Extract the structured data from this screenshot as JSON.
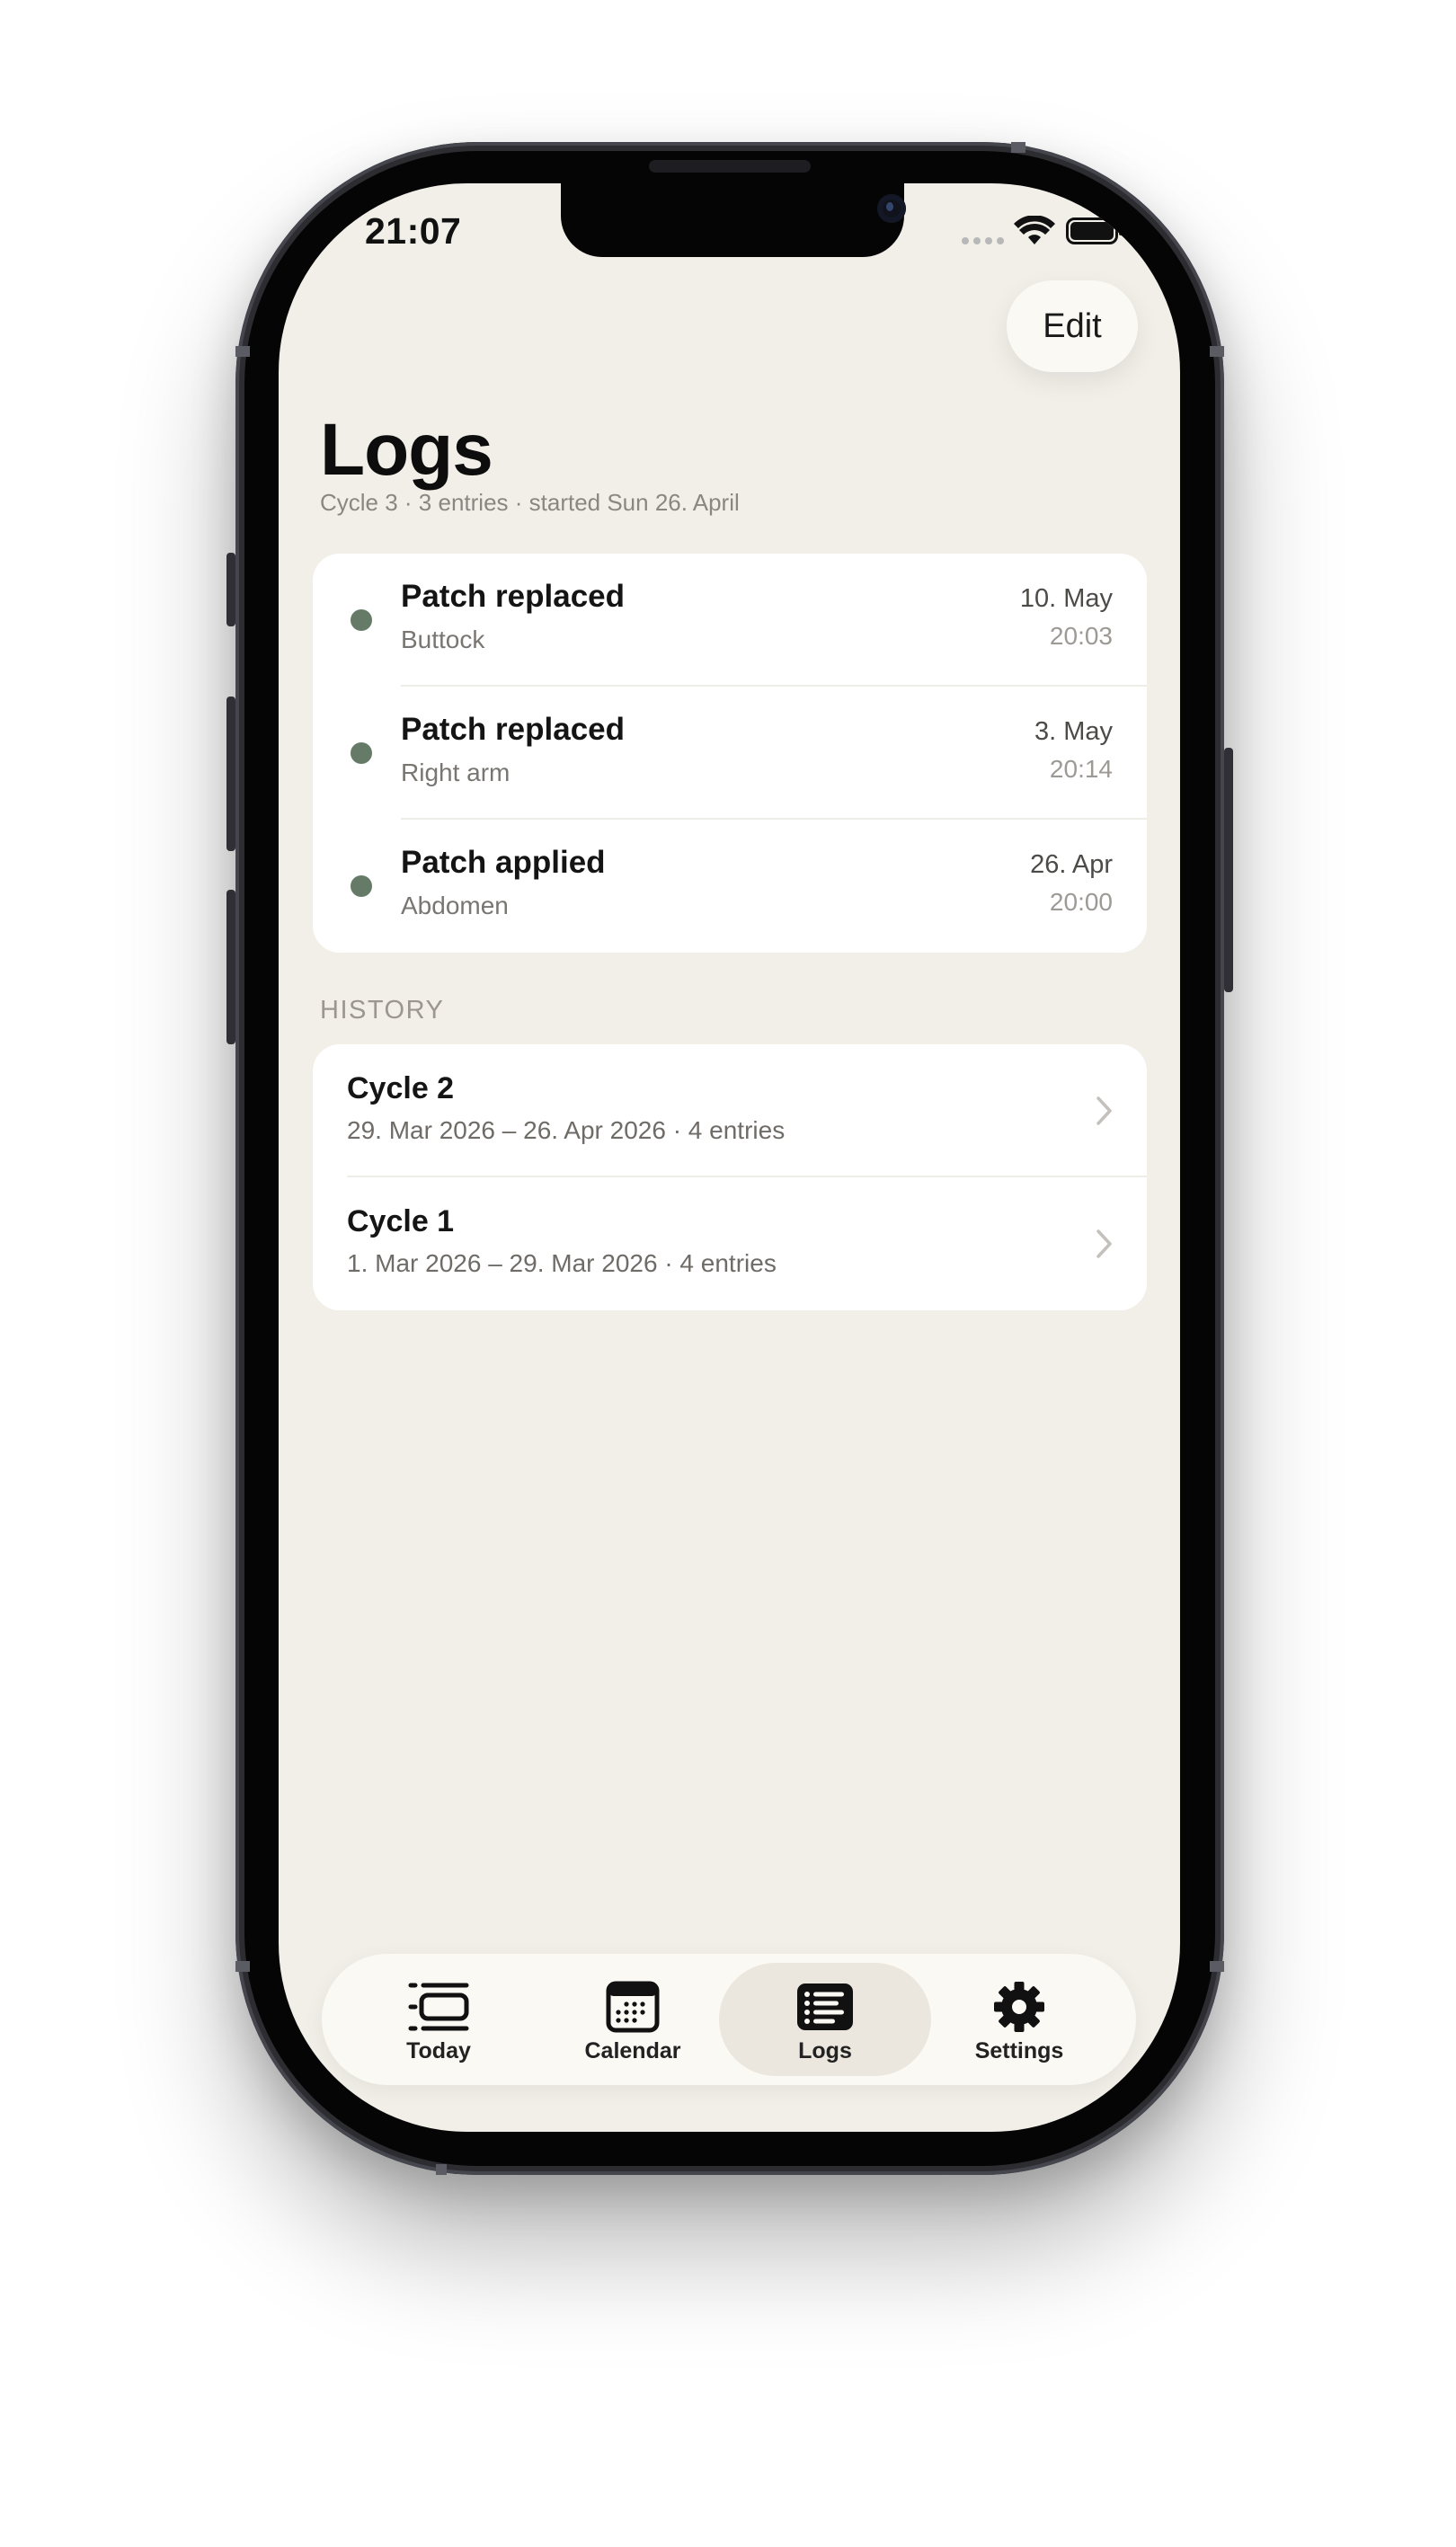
{
  "status_bar": {
    "time": "21:07"
  },
  "header": {
    "edit_label": "Edit",
    "title": "Logs",
    "subtitle": "Cycle 3 · 3 entries · started Sun 26. April"
  },
  "entries": [
    {
      "title": "Patch replaced",
      "location": "Buttock",
      "date": "10. May",
      "time": "20:03"
    },
    {
      "title": "Patch replaced",
      "location": "Right arm",
      "date": "3. May",
      "time": "20:14"
    },
    {
      "title": "Patch applied",
      "location": "Abdomen",
      "date": "26. Apr",
      "time": "20:00"
    }
  ],
  "history": {
    "label": "HISTORY",
    "cycles": [
      {
        "title": "Cycle 2",
        "summary": "29. Mar 2026 – 26. Apr 2026 · 4 entries"
      },
      {
        "title": "Cycle 1",
        "summary": "1. Mar 2026 – 29. Mar 2026 · 4 entries"
      }
    ]
  },
  "tabbar": {
    "tabs": [
      {
        "label": "Today",
        "icon": "today-icon"
      },
      {
        "label": "Calendar",
        "icon": "calendar-icon"
      },
      {
        "label": "Logs",
        "icon": "logs-icon",
        "active": true
      },
      {
        "label": "Settings",
        "icon": "gear-icon"
      }
    ]
  },
  "colors": {
    "background": "#f2efe9",
    "card": "#ffffff",
    "entry_dot": "#667b67",
    "tabbar": "#fbf9f3",
    "active_tab": "#ebe7df"
  }
}
